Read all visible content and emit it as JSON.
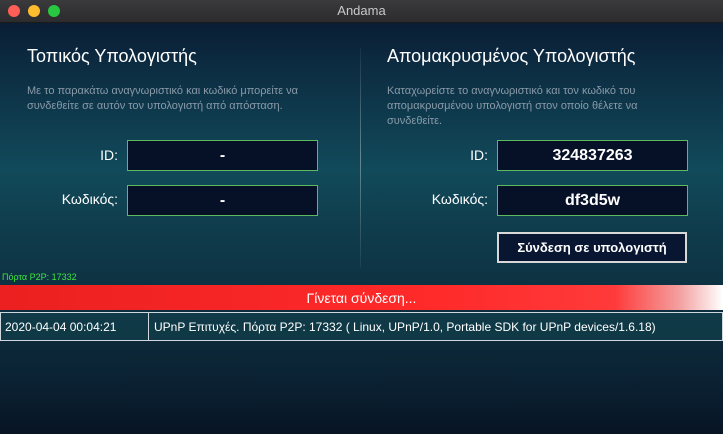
{
  "window": {
    "title": "Andama"
  },
  "local": {
    "title": "Τοπικός Υπολογιστής",
    "description": "Με το παρακάτω αναγνωριστικό και κωδικό μπορείτε να συνδεθείτε σε αυτόν τον υπολογιστή από απόσταση.",
    "id_label": "ID:",
    "id_value": "-",
    "password_label": "Κωδικός:",
    "password_value": "-"
  },
  "remote": {
    "title": "Απομακρυσμένος Υπολογιστής",
    "description": "Καταχωρείστε το αναγνωριστικό και τον κωδικό του απομακρυσμένου υπολογιστή στον οποίο θέλετε να συνδεθείτε.",
    "id_label": "ID:",
    "id_value": "324837263",
    "password_label": "Κωδικός:",
    "password_value": "df3d5w",
    "connect_button": "Σύνδεση σε υπολογιστή"
  },
  "port_status": "Πόρτα P2P: 17332",
  "status_bar": {
    "text": "Γίνεται σύνδεση..."
  },
  "log": [
    {
      "time": "2020-04-04 00:04:21",
      "message": "UPnP Επιτυχές. Πόρτα P2P: 17332 ( Linux, UPnP/1.0, Portable SDK for UPnP devices/1.6.18)"
    }
  ],
  "colors": {
    "status_red": "#ff2a2a",
    "field_border": "#5dbb5d",
    "port_text": "#3fe33f"
  }
}
